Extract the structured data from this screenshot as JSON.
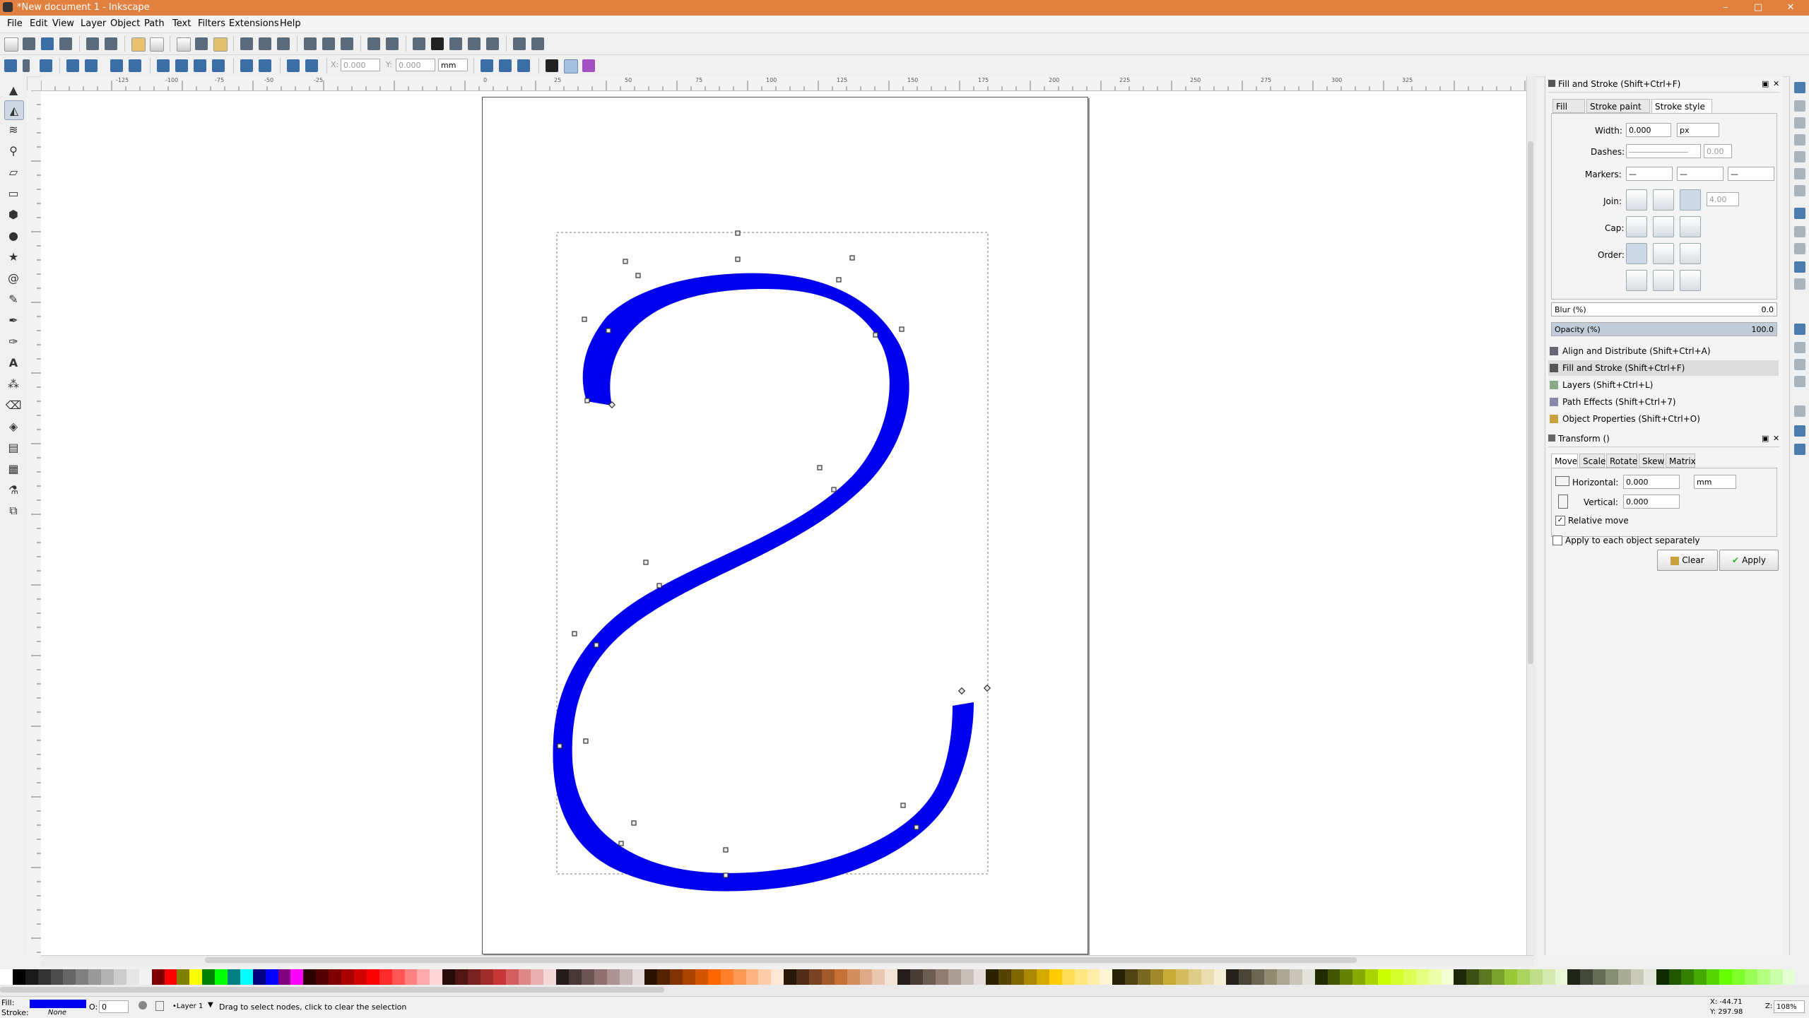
{
  "window": {
    "title": "*New document 1 - Inkscape",
    "minimize": "–",
    "maximize": "□",
    "close": "✕"
  },
  "menu": [
    "File",
    "Edit",
    "View",
    "Layer",
    "Object",
    "Path",
    "Text",
    "Filters",
    "Extensions",
    "Help"
  ],
  "controls": {
    "x_label": "X:",
    "x_value": "0.000",
    "y_label": "Y:",
    "y_value": "0.000",
    "unit": "mm"
  },
  "rulers": {
    "h_ticks": [
      "-125",
      "-100",
      "-75",
      "-50",
      "-25",
      "0",
      "25",
      "50",
      "75",
      "100",
      "125",
      "150",
      "175",
      "200",
      "225",
      "250",
      "275",
      "300",
      "325"
    ]
  },
  "panel": {
    "title": "Fill and Stroke (Shift+Ctrl+F)",
    "tabs": [
      "Fill",
      "Stroke paint",
      "Stroke style"
    ],
    "width_label": "Width:",
    "width_value": "0.000",
    "width_unit": "px",
    "dashes_label": "Dashes:",
    "dashes_value": "0.00",
    "markers_label": "Markers:",
    "join_label": "Join:",
    "join_value": "4.00",
    "cap_label": "Cap:",
    "order_label": "Order:",
    "blur_label": "Blur (%)",
    "blur_value": "0.0",
    "opacity_label": "Opacity (%)",
    "opacity_value": "100.0",
    "docked": [
      "Align and Distribute (Shift+Ctrl+A)",
      "Fill and Stroke (Shift+Ctrl+F)",
      "Layers (Shift+Ctrl+L)",
      "Path Effects  (Shift+Ctrl+7)",
      "Object Properties (Shift+Ctrl+O)"
    ],
    "transform_title": "Transform ()",
    "transform_tabs": [
      "Move",
      "Scale",
      "Rotate",
      "Skew",
      "Matrix"
    ],
    "horizontal_label": "Horizontal:",
    "horizontal_value": "0.000",
    "horizontal_unit": "mm",
    "vertical_label": "Vertical:",
    "vertical_value": "0.000",
    "relative_move": "Relative move",
    "apply_each": "Apply to each object separately",
    "clear": "Clear",
    "apply": "Apply"
  },
  "status": {
    "fill_label": "Fill:",
    "stroke_label": "Stroke:",
    "stroke_value": "None",
    "opacity_label": "O:",
    "opacity_value": "0",
    "layer": "•Layer 1",
    "message": "Drag to select nodes, click to clear the selection",
    "x_coord": "X: -44.71",
    "y_coord": "Y: 297.98",
    "zoom_label": "Z:",
    "zoom_value": "108%"
  },
  "colors": {
    "titlebar": "#e2813f",
    "path_fill": "#0000ee",
    "accent": "#3a6ea5"
  },
  "palette": [
    "#ffffff",
    "#000000",
    "#1a1a1a",
    "#333333",
    "#4d4d4d",
    "#666666",
    "#808080",
    "#999999",
    "#b3b3b3",
    "#cccccc",
    "#e6e6e6",
    "#f2f2f2",
    "#800000",
    "#ff0000",
    "#808000",
    "#ffff00",
    "#008000",
    "#00ff00",
    "#008080",
    "#00ffff",
    "#000080",
    "#0000ff",
    "#800080",
    "#ff00ff",
    "#2b0000",
    "#550000",
    "#800000",
    "#aa0000",
    "#d40000",
    "#ff0000",
    "#ff2a2a",
    "#ff5555",
    "#ff8080",
    "#ffaaaa",
    "#ffd5d5",
    "#280b0b",
    "#501616",
    "#782121",
    "#a02c2c",
    "#c83737",
    "#d35f5f",
    "#de8787",
    "#e9afaf",
    "#f4d7d7",
    "#241c1c",
    "#483737",
    "#6c5353",
    "#916f6f",
    "#ac9393",
    "#c8b7b7",
    "#e3dbdb",
    "#2b1100",
    "#552200",
    "#803300",
    "#aa4400",
    "#d45500",
    "#ff6600",
    "#ff7f2a",
    "#ff9955",
    "#ffb380",
    "#ffccaa",
    "#ffe6d5",
    "#28170b",
    "#502d16",
    "#784421",
    "#a05a2c",
    "#c87137",
    "#d38d5f",
    "#deaa87",
    "#e9c6af",
    "#f4e3d7",
    "#241f1c",
    "#483e37",
    "#6c5d53",
    "#917c6f",
    "#ac9d93",
    "#c8beb7",
    "#e3dedb",
    "#2b2200",
    "#554400",
    "#806600",
    "#aa8800",
    "#d4aa00",
    "#ffcc00",
    "#ffdd55",
    "#ffe680",
    "#ffeeaa",
    "#fff6d5",
    "#28220b",
    "#504416",
    "#786721",
    "#a0892c",
    "#c8ab37",
    "#d3bc5f",
    "#decd87",
    "#e9ddaf",
    "#f4eed7",
    "#24221c",
    "#484537",
    "#6c6753",
    "#918a6f",
    "#aca793",
    "#c8c4b7",
    "#e3e2db",
    "#222b00",
    "#445500",
    "#668000",
    "#88aa00",
    "#aad400",
    "#ccff00",
    "#d4ff2a",
    "#ddff55",
    "#e5ff80",
    "#eeffaa",
    "#f6ffd5",
    "#1e280b",
    "#3c5016",
    "#5a7821",
    "#78a02c",
    "#96c837",
    "#abd35f",
    "#c0de87",
    "#d5e9af",
    "#eaf4d7",
    "#212419",
    "#434837",
    "#646c53",
    "#858f6f",
    "#a7ac93",
    "#c8cab7",
    "#e3e4db",
    "#112b00",
    "#225500",
    "#338000",
    "#44aa00",
    "#55d400",
    "#66ff00",
    "#7fff2a",
    "#99ff55",
    "#b3ff80",
    "#ccffaa",
    "#e5ffd5"
  ]
}
